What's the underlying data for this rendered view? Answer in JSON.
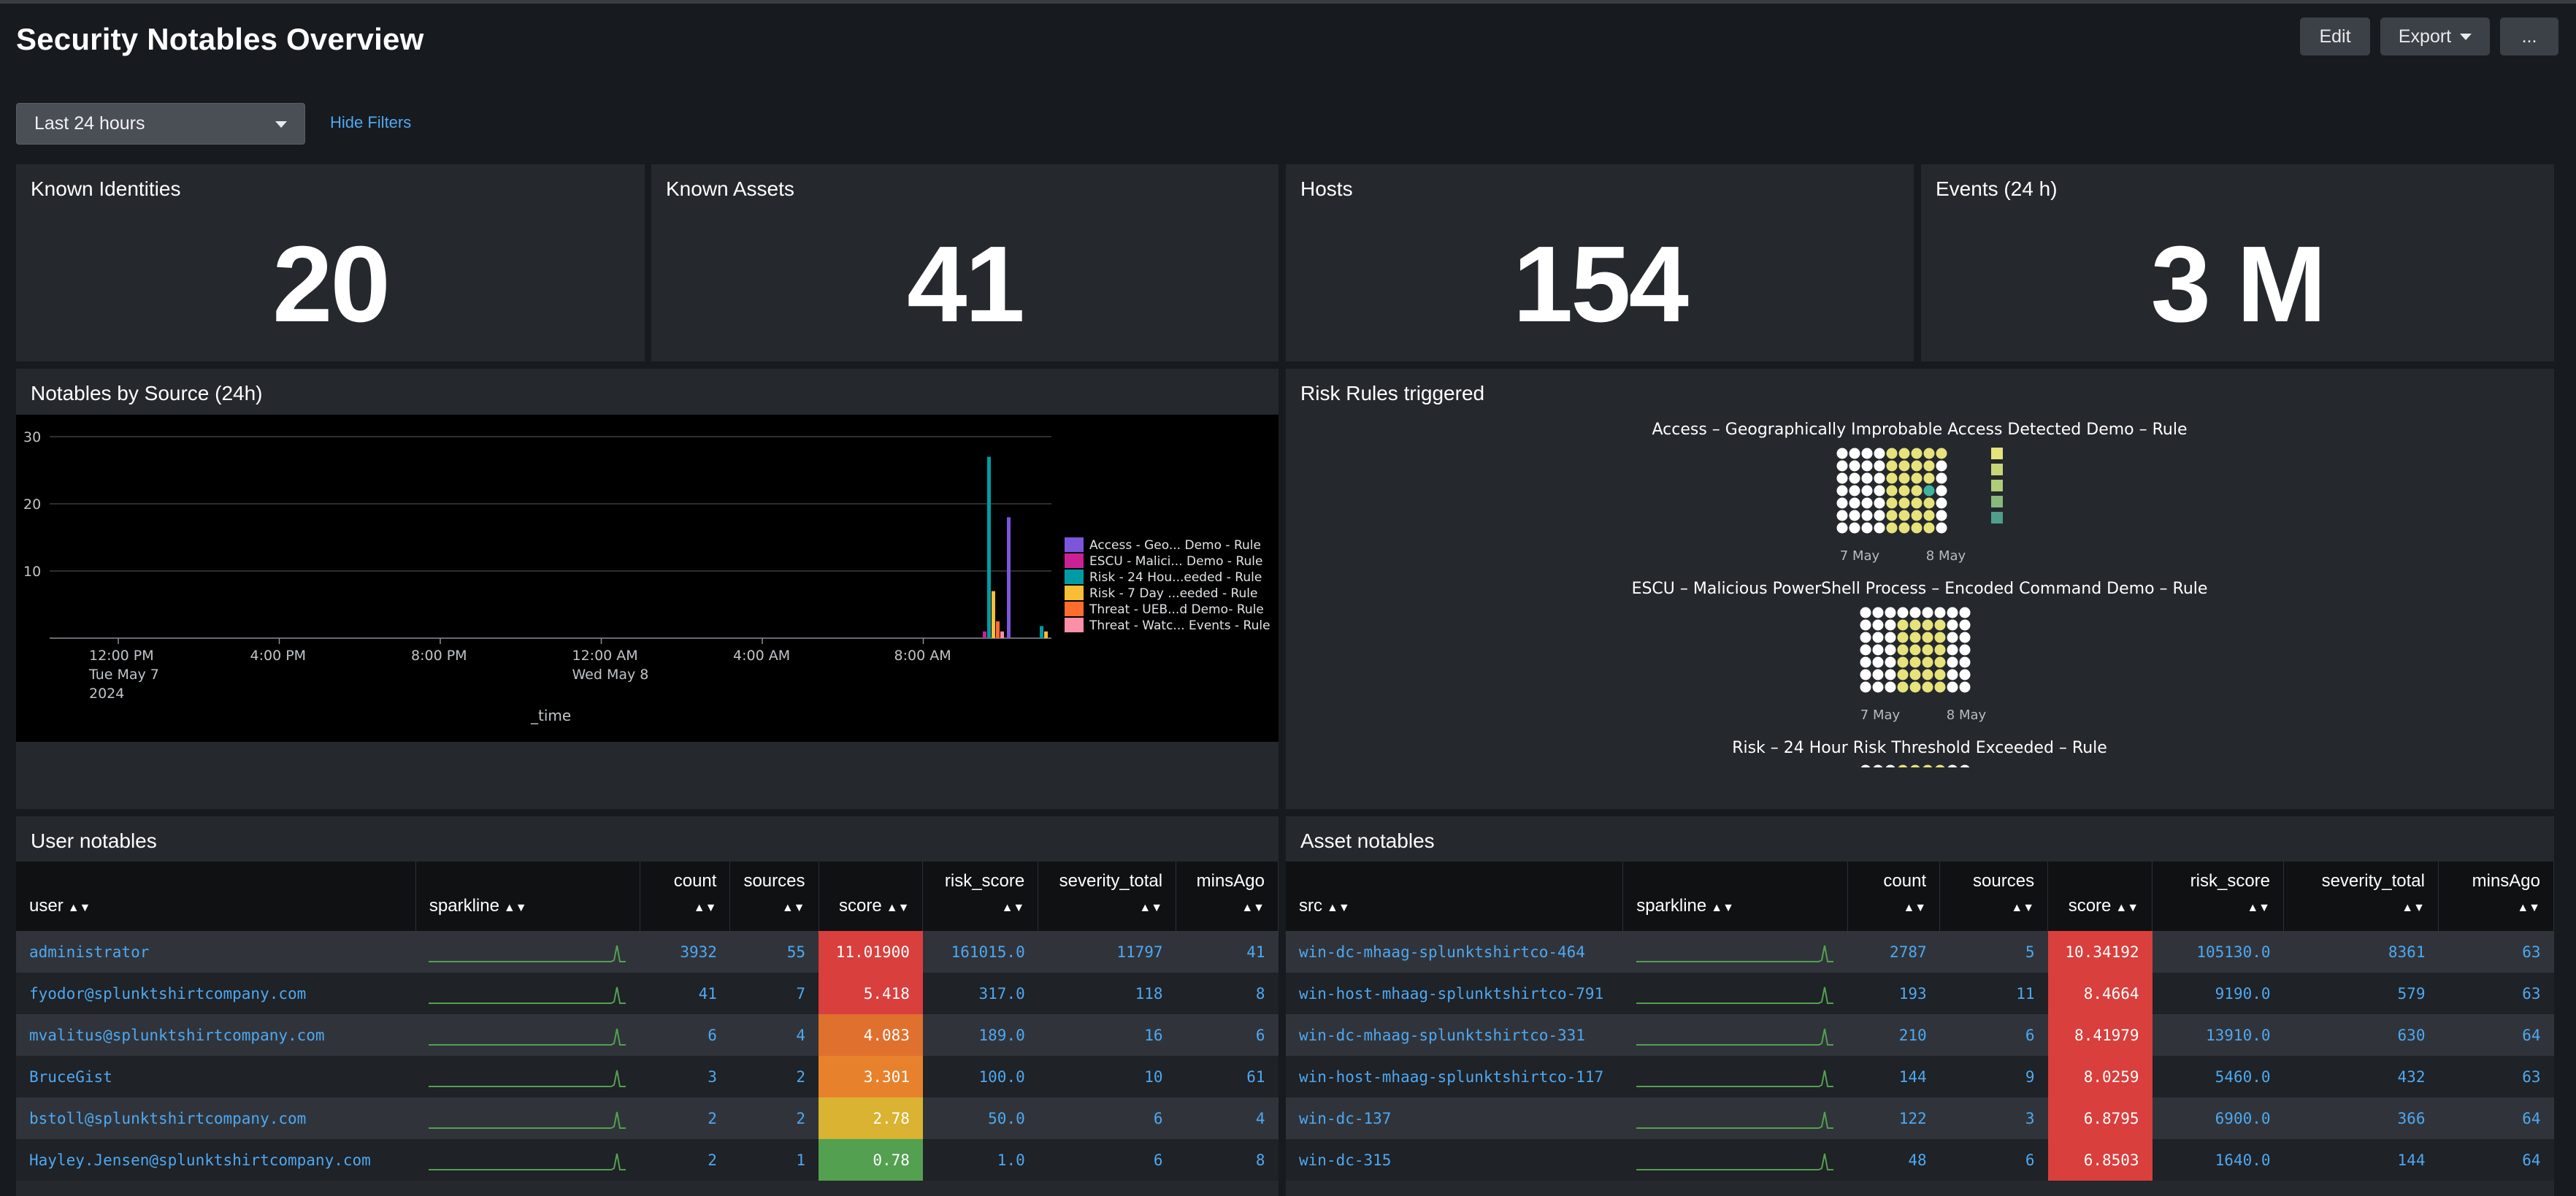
{
  "header": {
    "title": "Security Notables Overview",
    "edit_label": "Edit",
    "export_label": "Export",
    "more_label": "..."
  },
  "filters": {
    "time_range": "Last 24 hours",
    "hide_filters": "Hide Filters"
  },
  "single_values": [
    {
      "title": "Known Identities",
      "value": "20"
    },
    {
      "title": "Known Assets",
      "value": "41"
    },
    {
      "title": "Hosts",
      "value": "154"
    },
    {
      "title": "Events (24 h)",
      "value": "3 M"
    }
  ],
  "notables_chart": {
    "title": "Notables by Source (24h)",
    "chart_data": {
      "type": "bar",
      "xlabel": "_time",
      "ylabel": "",
      "ylim": [
        0,
        30
      ],
      "yticks": [
        10,
        20,
        30
      ],
      "grid": true,
      "legend_position": "right",
      "x_tick_labels": [
        {
          "label": "12:00 PM",
          "sub": [
            "Tue May 7",
            "2024"
          ]
        },
        {
          "label": "4:00 PM",
          "sub": []
        },
        {
          "label": "8:00 PM",
          "sub": []
        },
        {
          "label": "12:00 AM",
          "sub": [
            "Wed May 8"
          ]
        },
        {
          "label": "4:00 AM",
          "sub": []
        },
        {
          "label": "8:00 AM",
          "sub": []
        }
      ],
      "series": [
        {
          "name": "Access - Geo... Demo - Rule",
          "color": "#7b56db",
          "values": [
            0,
            18,
            0
          ]
        },
        {
          "name": "ESCU - Malici... Demo - Rule",
          "color": "#cb2196",
          "values": [
            1,
            0,
            0
          ]
        },
        {
          "name": "Risk - 24 Hou...eeded - Rule",
          "color": "#009ca6",
          "values": [
            27,
            0,
            1.8
          ]
        },
        {
          "name": "Risk - 7 Day ...eeded - Rule",
          "color": "#f8be34",
          "values": [
            7,
            0,
            1
          ]
        },
        {
          "name": "Threat - UEB...d Demo- Rule",
          "color": "#ff6d2e",
          "values": [
            2.5,
            0,
            0
          ]
        },
        {
          "name": "Threat - Watc... Events - Rule",
          "color": "#fd8fa8",
          "values": [
            1,
            0,
            0
          ]
        }
      ]
    }
  },
  "risk_rules": {
    "title": "Risk Rules triggered",
    "groups": [
      {
        "title": "Access – Geographically Improbable Access Detected Demo – Rule",
        "dates": [
          "7 May",
          "8 May"
        ]
      },
      {
        "title": "ESCU – Malicious PowerShell Process – Encoded Command Demo – Rule",
        "dates": [
          "7 May",
          "8 May"
        ]
      },
      {
        "title": "Risk – 24 Hour Risk Threshold Exceeded – Rule",
        "dates": []
      }
    ]
  },
  "user_notables": {
    "title": "User notables",
    "columns": [
      "user",
      "sparkline",
      "count",
      "sources",
      "score",
      "risk_score",
      "severity_total",
      "minsAgo"
    ],
    "rows": [
      {
        "user": "administrator",
        "count": "3932",
        "sources": "55",
        "score": "11.01900",
        "risk_score": "161015.0",
        "severity_total": "11797",
        "minsAgo": "41",
        "score_color": "#d93f3c"
      },
      {
        "user": "fyodor@splunktshirtcompany.com",
        "count": "41",
        "sources": "7",
        "score": "5.418",
        "risk_score": "317.0",
        "severity_total": "118",
        "minsAgo": "8",
        "score_color": "#d93f3c"
      },
      {
        "user": "mvalitus@splunktshirtcompany.com",
        "count": "6",
        "sources": "4",
        "score": "4.083",
        "risk_score": "189.0",
        "severity_total": "16",
        "minsAgo": "6",
        "score_color": "#e0702d"
      },
      {
        "user": "BruceGist",
        "count": "3",
        "sources": "2",
        "score": "3.301",
        "risk_score": "100.0",
        "severity_total": "10",
        "minsAgo": "61",
        "score_color": "#e8812b"
      },
      {
        "user": "bstoll@splunktshirtcompany.com",
        "count": "2",
        "sources": "2",
        "score": "2.78",
        "risk_score": "50.0",
        "severity_total": "6",
        "minsAgo": "4",
        "score_color": "#d9b331"
      },
      {
        "user": "Hayley.Jensen@splunktshirtcompany.com",
        "count": "2",
        "sources": "1",
        "score": "0.78",
        "risk_score": "1.0",
        "severity_total": "6",
        "minsAgo": "8",
        "score_color": "#53a051"
      }
    ]
  },
  "asset_notables": {
    "title": "Asset notables",
    "columns": [
      "src",
      "sparkline",
      "count",
      "sources",
      "score",
      "risk_score",
      "severity_total",
      "minsAgo"
    ],
    "rows": [
      {
        "src": "win-dc-mhaag-splunktshirtco-464",
        "count": "2787",
        "sources": "5",
        "score": "10.34192",
        "risk_score": "105130.0",
        "severity_total": "8361",
        "minsAgo": "63",
        "score_color": "#d93f3c"
      },
      {
        "src": "win-host-mhaag-splunktshirtco-791",
        "count": "193",
        "sources": "11",
        "score": "8.4664",
        "risk_score": "9190.0",
        "severity_total": "579",
        "minsAgo": "63",
        "score_color": "#d93f3c"
      },
      {
        "src": "win-dc-mhaag-splunktshirtco-331",
        "count": "210",
        "sources": "6",
        "score": "8.41979",
        "risk_score": "13910.0",
        "severity_total": "630",
        "minsAgo": "64",
        "score_color": "#d93f3c"
      },
      {
        "src": "win-host-mhaag-splunktshirtco-117",
        "count": "144",
        "sources": "9",
        "score": "8.0259",
        "risk_score": "5460.0",
        "severity_total": "432",
        "minsAgo": "63",
        "score_color": "#d93f3c"
      },
      {
        "src": "win-dc-137",
        "count": "122",
        "sources": "3",
        "score": "6.8795",
        "risk_score": "6900.0",
        "severity_total": "366",
        "minsAgo": "64",
        "score_color": "#d93f3c"
      },
      {
        "src": "win-dc-315",
        "count": "48",
        "sources": "6",
        "score": "6.8503",
        "risk_score": "1640.0",
        "severity_total": "144",
        "minsAgo": "64",
        "score_color": "#d93f3c"
      }
    ]
  }
}
